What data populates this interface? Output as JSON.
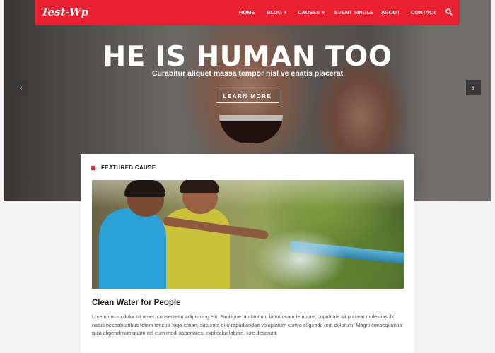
{
  "brand": {
    "logo": "Test-Wp",
    "accent": "#e8202f"
  },
  "nav": {
    "items": [
      {
        "label": "HOME",
        "dropdown": false
      },
      {
        "label": "BLOG",
        "dropdown": true
      },
      {
        "label": "CAUSES",
        "dropdown": true
      },
      {
        "label": "EVENT SINGLE",
        "dropdown": false
      },
      {
        "label": "ABOUT",
        "dropdown": false
      },
      {
        "label": "CONTACT",
        "dropdown": false
      }
    ],
    "search_icon": "search-icon"
  },
  "hero": {
    "title": "HE IS HUMAN TOO",
    "subtitle": "Curabitur aliquet massa tempor nisl ve enatis placerat",
    "button": "LEARN MORE",
    "prev_icon": "chevron-left-icon",
    "next_icon": "chevron-right-icon"
  },
  "featured": {
    "label": "FEATURED CAUSE",
    "title": "Clean Water for People",
    "description": "Lorem ipsum dolor sit amet, consectetur adipisicing elit. Similique laudantium laboriosam tempore, cupiditate sit placeat molestias illo natus necessitatibus totam tenetur fuga ipsum, sapiente quo repudiandae voluptatum cum a eligendi, rem dolorum. Magni consequuntur quia eligendi numquam vel eum modi asperiores, explicabo labore, iure deserunt."
  }
}
